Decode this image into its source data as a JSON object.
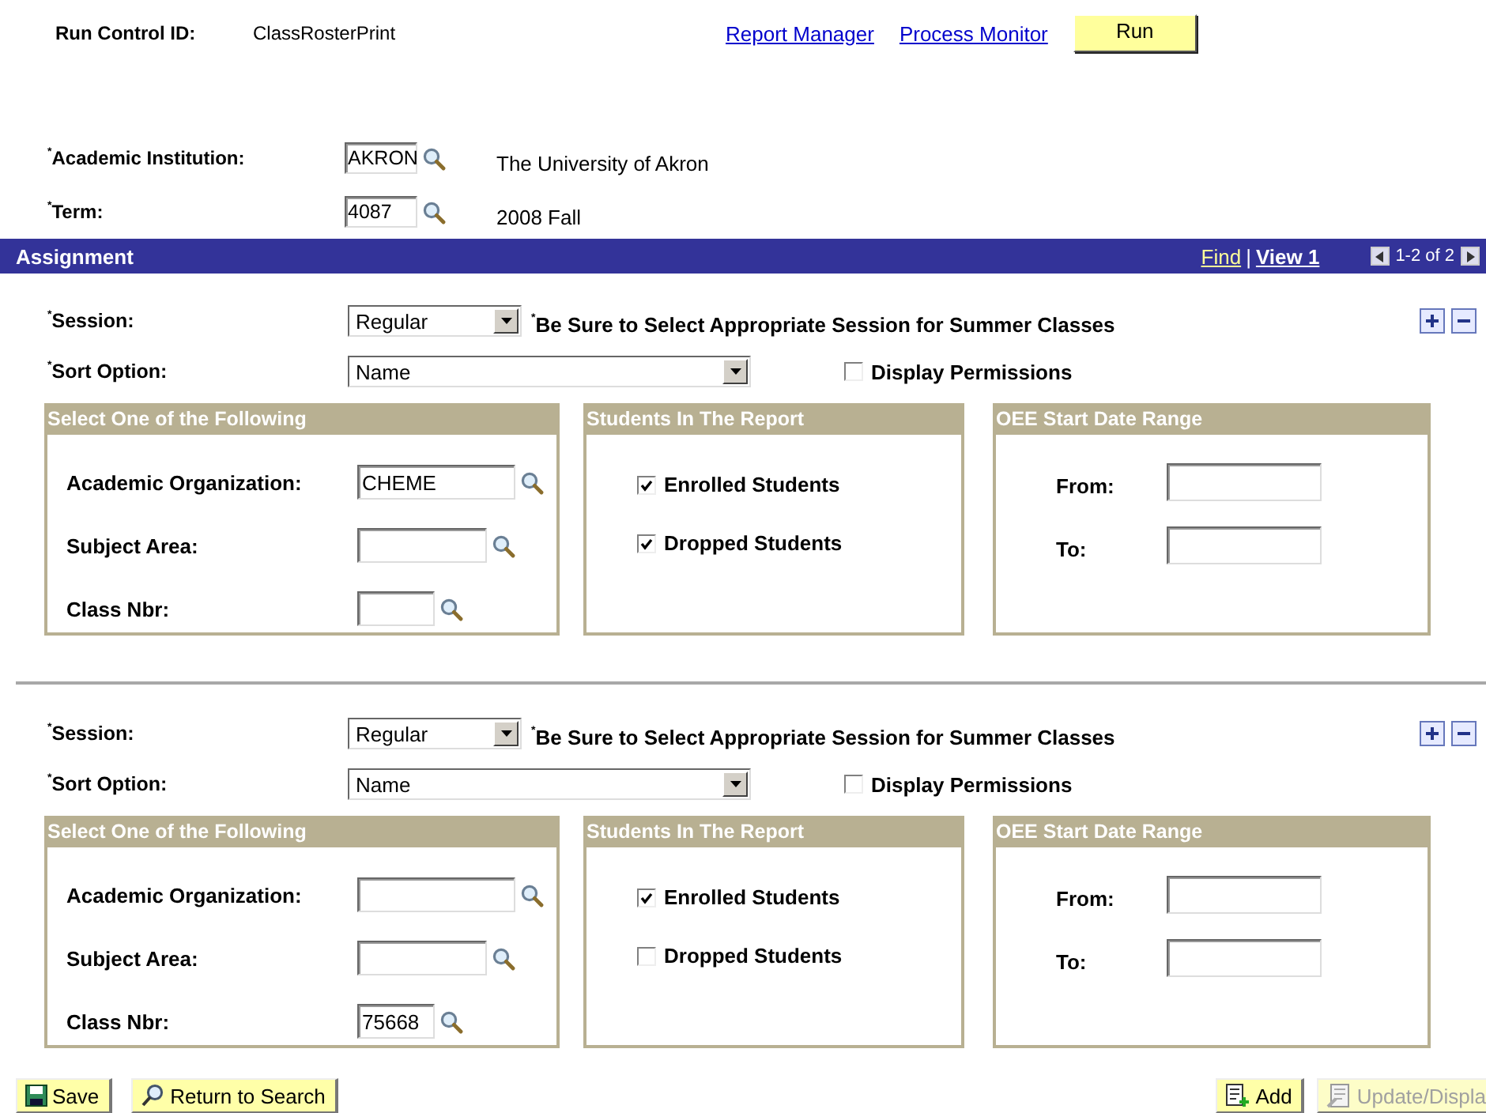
{
  "header": {
    "run_control_label": "Run Control ID:",
    "run_control_value": "ClassRosterPrint",
    "links": [
      "Report Manager",
      "Process Monitor"
    ],
    "run_button": "Run"
  },
  "keys": [
    {
      "label": "$^{*}$Academic Institution:",
      "value": "AKRON",
      "description": "The University of Akron"
    },
    {
      "label": "$^{*}$Term:",
      "value": "4087",
      "description": "2008 Fall"
    }
  ],
  "assignment": {
    "title": "Assignment",
    "find": "Find",
    "separator": "|",
    "view": "View 1",
    "range": "1-2 of 2",
    "rows": [
      {
        "session_label": "$^{*}$Session:",
        "session_value": "Regular",
        "session_note": "$^{*}$Be Sure to Select Appropriate Session for Summer Classes",
        "sort_label": "$^{*}$Sort Option:",
        "sort_value": "Name",
        "display_permissions": {
          "label": "Display Permissions",
          "checked": false
        },
        "select_box": {
          "title": "Select One of the Following",
          "fields": [
            {
              "label": "Academic Organization:",
              "value": "CHEME"
            },
            {
              "label": "Subject Area:"
            },
            {
              "label": "Class Nbr:"
            }
          ]
        },
        "students_box": {
          "title": "Students In The Report",
          "options": [
            {
              "label": "Enrolled Students",
              "checked": true
            },
            {
              "label": "Dropped Students",
              "checked": true
            }
          ]
        },
        "date_box": {
          "title": "OEE Start Date Range",
          "fields": [
            {
              "label": "From:"
            },
            {
              "label": "To:"
            }
          ]
        }
      },
      {
        "session_label": "$^{*}$Session:",
        "session_value": "Regular",
        "session_note": "$^{*}$Be Sure to Select Appropriate Session for Summer Classes",
        "sort_label": "$^{*}$Sort Option:",
        "sort_value": "Name",
        "display_permissions": {
          "label": "Display Permissions",
          "checked": false
        },
        "select_box": {
          "title": "Select One of the Following",
          "fields": [
            {
              "label": "Academic Organization:"
            },
            {
              "label": "Subject Area:"
            },
            {
              "label": "Class Nbr:",
              "value": "75668"
            }
          ]
        },
        "students_box": {
          "title": "Students In The Report",
          "options": [
            {
              "label": "Enrolled Students",
              "checked": true
            },
            {
              "label": "Dropped Students",
              "checked": false
            }
          ]
        },
        "date_box": {
          "title": "OEE Start Date Range",
          "fields": [
            {
              "label": "From:"
            },
            {
              "label": "To:"
            }
          ]
        }
      }
    ]
  },
  "footer": {
    "left": [
      {
        "label": "Save",
        "kind": "save",
        "disabled": false
      },
      {
        "label": "Return to Search",
        "kind": "search",
        "disabled": false
      }
    ],
    "right": [
      {
        "label": "Add",
        "kind": "add",
        "disabled": false
      },
      {
        "label": "Update/Displa",
        "kind": "update",
        "disabled": true
      }
    ]
  }
}
